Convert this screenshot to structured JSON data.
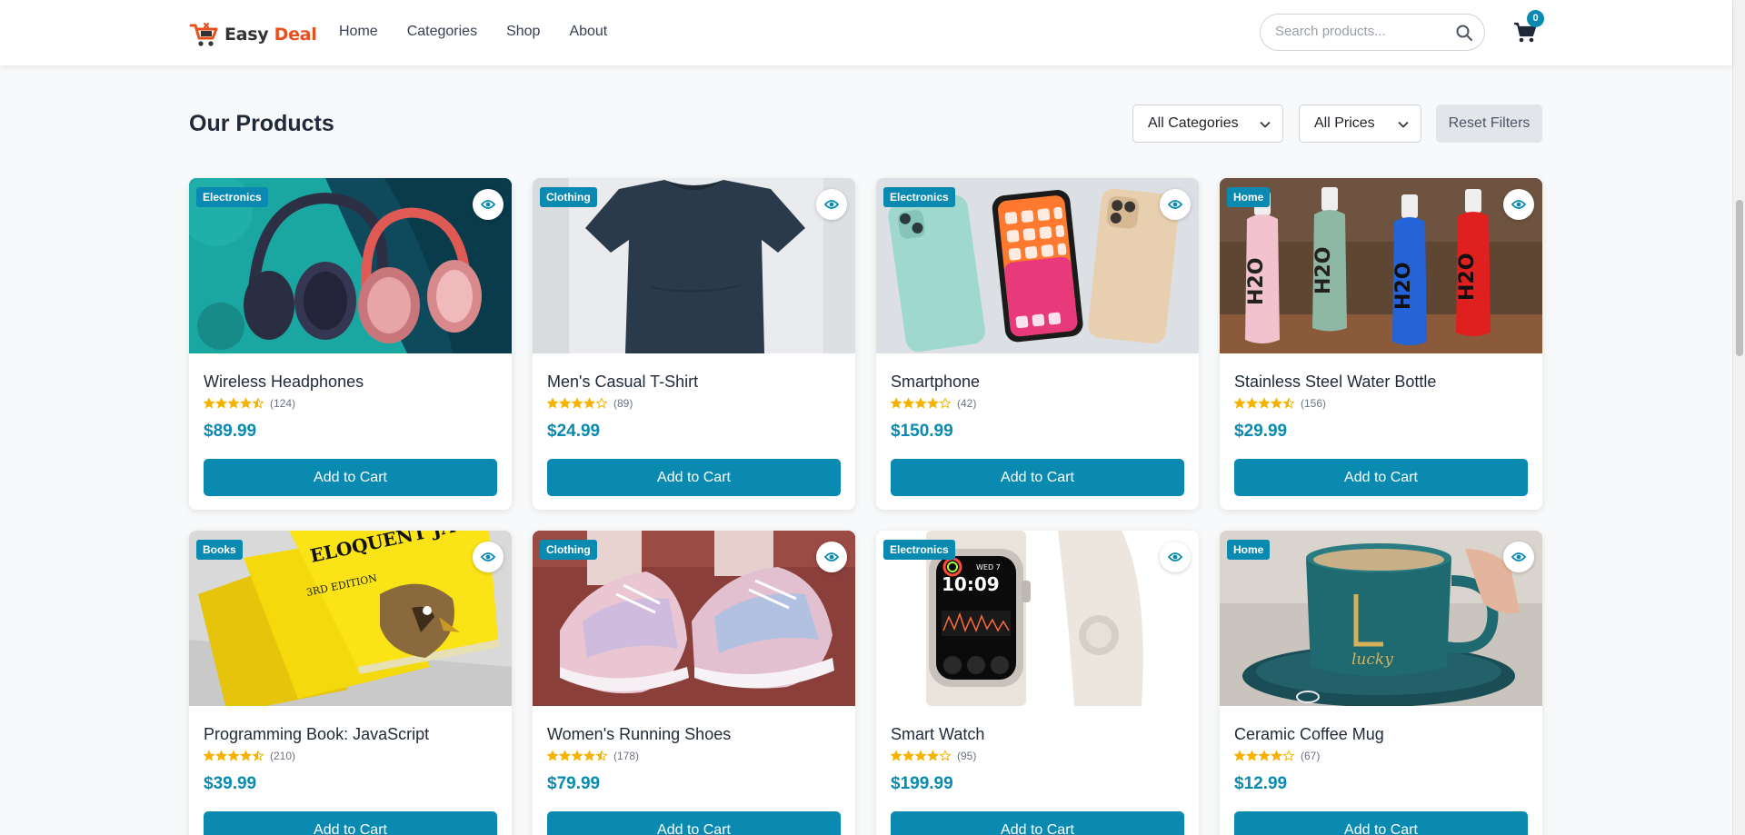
{
  "header": {
    "logo_part1": "Easy",
    "logo_part2": "Deal",
    "nav": [
      {
        "label": "Home"
      },
      {
        "label": "Categories"
      },
      {
        "label": "Shop"
      },
      {
        "label": "About"
      }
    ],
    "search_placeholder": "Search products...",
    "cart_count": "0"
  },
  "main": {
    "title": "Our Products",
    "category_filter": "All Categories",
    "price_filter": "All Prices",
    "reset_label": "Reset Filters",
    "add_to_cart_label": "Add to Cart"
  },
  "colors": {
    "accent": "#0a8ab0",
    "logo_orange": "#e8501c",
    "star": "#f5b301"
  },
  "products": [
    {
      "category": "Electronics",
      "name": "Wireless Headphones",
      "rating": 4.5,
      "reviews": "(124)",
      "price": "$89.99",
      "image": "headphones"
    },
    {
      "category": "Clothing",
      "name": "Men's Casual T-Shirt",
      "rating": 4,
      "reviews": "(89)",
      "price": "$24.99",
      "image": "tshirt"
    },
    {
      "category": "Electronics",
      "name": "Smartphone",
      "rating": 4,
      "reviews": "(42)",
      "price": "$150.99",
      "image": "smartphones"
    },
    {
      "category": "Home",
      "name": "Stainless Steel Water Bottle",
      "rating": 4.5,
      "reviews": "(156)",
      "price": "$29.99",
      "image": "bottles"
    },
    {
      "category": "Books",
      "name": "Programming Book: JavaScript",
      "rating": 4.5,
      "reviews": "(210)",
      "price": "$39.99",
      "image": "book",
      "cover_title": "ELOQUENT JAVASCRIPT",
      "cover_edition": "3RD EDITION"
    },
    {
      "category": "Clothing",
      "name": "Women's Running Shoes",
      "rating": 4.5,
      "reviews": "(178)",
      "price": "$79.99",
      "image": "shoes"
    },
    {
      "category": "Electronics",
      "name": "Smart Watch",
      "rating": 4,
      "reviews": "(95)",
      "price": "$199.99",
      "image": "watch",
      "watch_time": "10:09",
      "watch_date": "WED 7"
    },
    {
      "category": "Home",
      "name": "Ceramic Coffee Mug",
      "rating": 4,
      "reviews": "(67)",
      "price": "$12.99",
      "image": "mug",
      "mug_text": "lucky"
    }
  ]
}
